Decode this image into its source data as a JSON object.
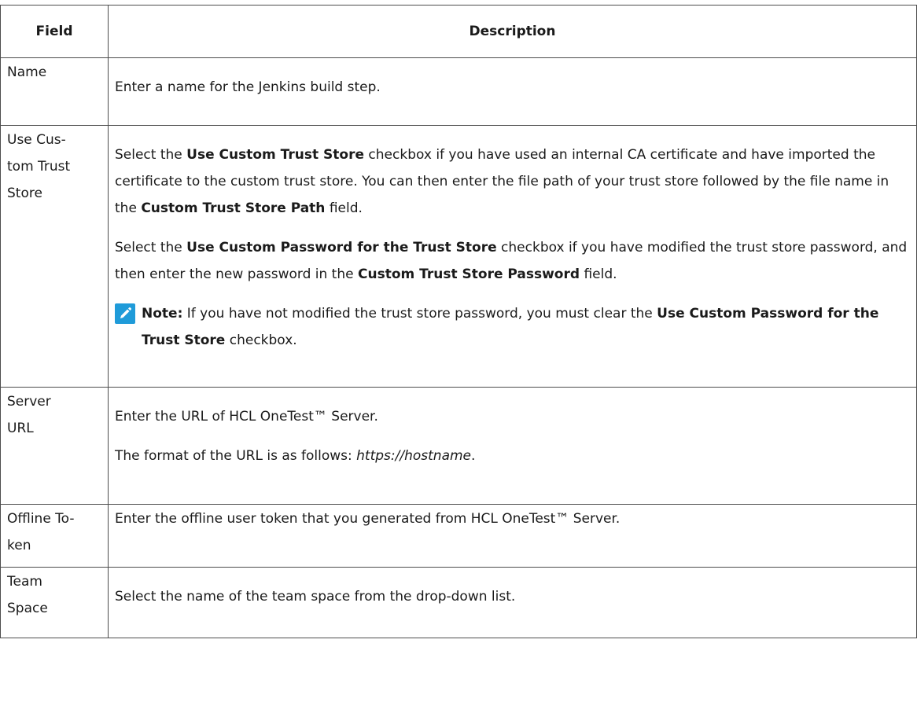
{
  "table": {
    "headers": {
      "field": "Field",
      "description": "Description"
    },
    "rows": {
      "name": {
        "field": "Name",
        "desc": "Enter a name for the Jenkins build step."
      },
      "trust": {
        "field_lines": [
          "Use Cus-",
          "tom Trust",
          "Store"
        ],
        "p1": {
          "t1": "Select the ",
          "b1": "Use Custom Trust Store",
          "t2": " checkbox if you have used an internal CA certificate and have imported the certificate to the custom trust store. You can then enter the file path of your trust store followed by the file name in the ",
          "b2": "Custom Trust Store Path",
          "t3": " field."
        },
        "p2": {
          "t1": "Select the ",
          "b1": "Use Custom Password for the Trust Store",
          "t2": " checkbox if you have modified the trust store password, and then enter the new password in the ",
          "b2": "Custom Trust Store Password",
          "t3": " field."
        },
        "note": {
          "label": "Note:",
          "t1": " If you have not modified the trust store password, you must clear the ",
          "b1": "Use Custom Password for the Trust Store",
          "t2": " checkbox.",
          "icon": "pencil-note-icon",
          "icon_color": "#1f9bd9"
        }
      },
      "server": {
        "field_lines": [
          "Server",
          "URL"
        ],
        "p1": "Enter the URL of HCL OneTest™ Server.",
        "p2_text": "The format of the URL is as follows: ",
        "p2_url": "https://hostname",
        "p2_end": "."
      },
      "offline": {
        "field_lines": [
          "Offline To-",
          "ken"
        ],
        "desc": "Enter the offline user token that you generated from HCL OneTest™ Server."
      },
      "team": {
        "field_lines": [
          "Team",
          "Space"
        ],
        "desc": "Select the name of the team space from the drop-down list."
      }
    }
  }
}
